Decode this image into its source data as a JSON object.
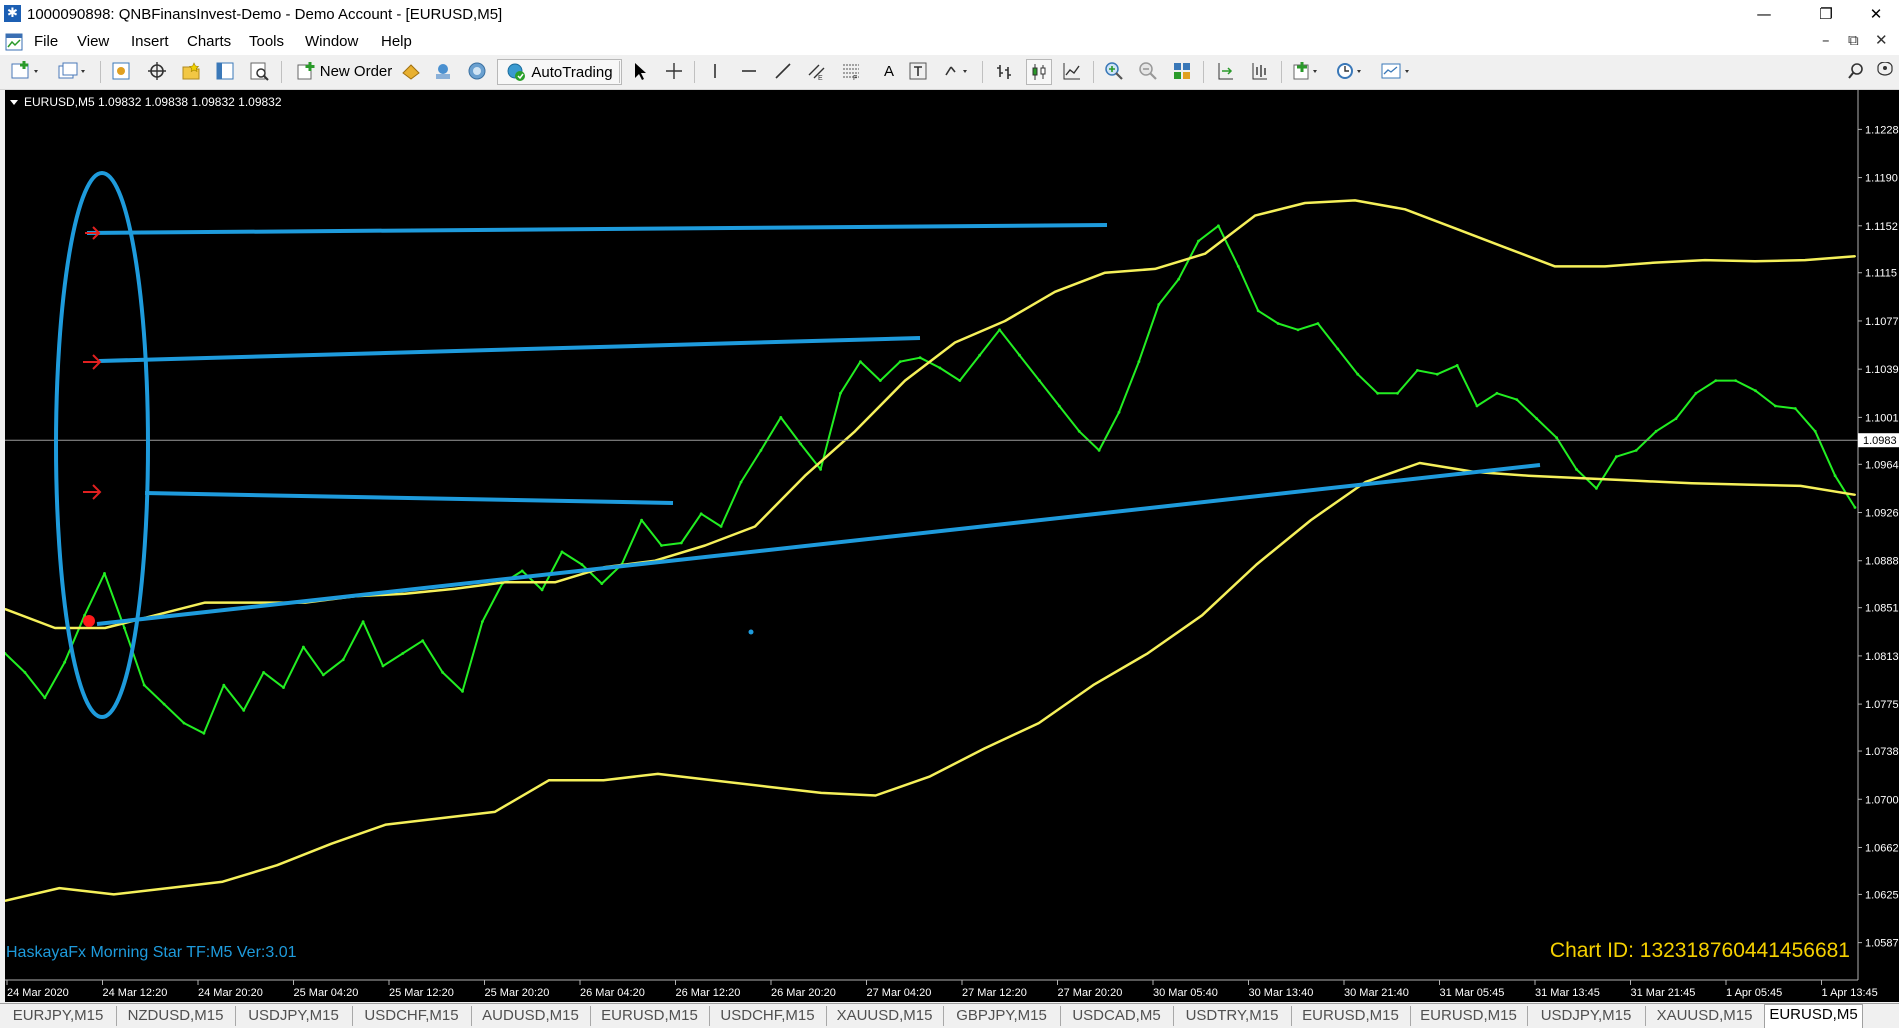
{
  "window": {
    "title": "1000090898: QNBFinansInvest-Demo - Demo Account - [EURUSD,M5]",
    "minimize": "—",
    "maximize": "❐",
    "close": "✕"
  },
  "menu": {
    "items": [
      "File",
      "View",
      "Insert",
      "Charts",
      "Tools",
      "Window",
      "Help"
    ],
    "restore": "–",
    "maximize": "⧉",
    "close": "✕"
  },
  "toolbar": {
    "new_order": "New Order",
    "autotrading": "AutoTrading",
    "text_tool": "A",
    "icons": [
      "new-chart-icon",
      "profiles-icon",
      "market-watch-icon",
      "data-window-icon",
      "navigator-icon",
      "terminal-icon",
      "strategy-tester-icon",
      "new-order-icon",
      "metaeditor-icon",
      "signals-icon",
      "community-icon",
      "autotrading-icon",
      "cursor-icon",
      "crosshair-icon",
      "vertical-line-icon",
      "horizontal-line-icon",
      "trendline-icon",
      "equidistant-channel-icon",
      "fibonacci-icon",
      "text-icon",
      "text-label-icon",
      "arrows-icon",
      "bar-chart-icon",
      "candlesticks-icon",
      "line-chart-icon",
      "zoom-in-icon",
      "zoom-out-icon",
      "tile-windows-icon",
      "chart-shift-icon",
      "autoscroll-icon",
      "indicators-icon",
      "periods-icon",
      "templates-icon"
    ]
  },
  "chart": {
    "header": "EURUSD,M5  1.09832 1.09838 1.09832 1.09832",
    "indicator_label": "HaskayaFx Morning Star TF:M5 Ver:3.01",
    "chart_id": "Chart ID: 132318760441456681",
    "current_price": "1.0983"
  },
  "chart_data": {
    "type": "line",
    "symbol": "EURUSD",
    "timeframe": "M5",
    "ylim": [
      1.0567,
      1.1248
    ],
    "y_ticks": [
      "1.1228",
      "1.1190",
      "1.1152",
      "1.1115",
      "1.1077",
      "1.1039",
      "1.1001",
      "1.0964",
      "1.0926",
      "1.0888",
      "1.0851",
      "1.0813",
      "1.0775",
      "1.0738",
      "1.0700",
      "1.0662",
      "1.0625",
      "1.0587"
    ],
    "x_ticks": [
      "24 Mar 2020",
      "24 Mar 12:20",
      "24 Mar 20:20",
      "25 Mar 04:20",
      "25 Mar 12:20",
      "25 Mar 20:20",
      "26 Mar 04:20",
      "26 Mar 12:20",
      "26 Mar 20:20",
      "27 Mar 04:20",
      "27 Mar 12:20",
      "27 Mar 20:20",
      "30 Mar 05:40",
      "30 Mar 13:40",
      "30 Mar 21:40",
      "31 Mar 05:45",
      "31 Mar 13:45",
      "31 Mar 21:45",
      "1 Apr 05:45",
      "1 Apr 13:45"
    ],
    "current_price": 1.0983,
    "grid": false,
    "series": [
      {
        "color": "#22ee22",
        "values": [
          1.0815,
          1.08,
          1.078,
          1.0808,
          1.0845,
          1.0878,
          1.0835,
          1.079,
          1.0775,
          1.076,
          1.0752,
          1.079,
          1.077,
          1.08,
          1.0788,
          1.082,
          1.0798,
          1.081,
          1.084,
          1.0805,
          1.0815,
          1.0825,
          1.08,
          1.0785,
          1.084,
          1.087,
          1.088,
          1.0865,
          1.0895,
          1.0885,
          1.087,
          1.0885,
          1.092,
          1.09,
          1.0902,
          1.0925,
          1.0915,
          1.095,
          1.0975,
          1.1001,
          1.098,
          1.096,
          1.102,
          1.1045,
          1.103,
          1.1045,
          1.1048,
          1.104,
          1.103,
          1.105,
          1.107,
          1.105,
          1.103,
          1.101,
          1.099,
          1.0975,
          1.1005,
          1.1045,
          1.109,
          1.111,
          1.114,
          1.1152,
          1.112,
          1.1085,
          1.1075,
          1.107,
          1.1075,
          1.1055,
          1.1035,
          1.102,
          1.102,
          1.1038,
          1.1035,
          1.1042,
          1.101,
          1.102,
          1.1015,
          1.1,
          1.0985,
          1.096,
          1.0945,
          1.097,
          1.0975,
          1.099,
          1.1,
          1.102,
          1.103,
          1.103,
          1.1022,
          1.101,
          1.1008,
          1.099,
          1.0955,
          1.093
        ]
      },
      {
        "color": "#f5f05a",
        "values": [
          1.085,
          1.0835,
          1.0835,
          1.0845,
          1.0855,
          1.0855,
          1.0855,
          1.086,
          1.0862,
          1.0866,
          1.0871,
          1.0871,
          1.0883,
          1.0888,
          1.09,
          1.0915,
          1.0955,
          1.099,
          1.103,
          1.106,
          1.1077,
          1.11,
          1.1115,
          1.1118,
          1.113,
          1.116,
          1.117,
          1.1172,
          1.1165,
          1.115,
          1.1135,
          1.112,
          1.112,
          1.1123,
          1.1125,
          1.1124,
          1.1125,
          1.1128
        ]
      },
      {
        "color": "#f5f05a",
        "values": [
          1.062,
          1.063,
          1.0625,
          1.063,
          1.0635,
          1.0648,
          1.0665,
          1.068,
          1.0685,
          1.069,
          1.0715,
          1.0715,
          1.072,
          1.0715,
          1.071,
          1.0705,
          1.0703,
          1.0718,
          1.074,
          1.076,
          1.079,
          1.0815,
          1.0845,
          1.0885,
          1.092,
          1.095,
          1.0965,
          1.0958,
          1.0955,
          1.0953,
          1.0951,
          1.0949,
          1.0948,
          1.0947,
          1.094
        ]
      }
    ]
  },
  "tabs": [
    "EURJPY,M15",
    "NZDUSD,M15",
    "USDJPY,M15",
    "USDCHF,M15",
    "AUDUSD,M15",
    "EURUSD,M15",
    "USDCHF,M15",
    "XAUUSD,M15",
    "GBPJPY,M15",
    "USDCAD,M5",
    "USDTRY,M15",
    "EURUSD,M15",
    "EURUSD,M15",
    "USDJPY,M15",
    "XAUUSD,M15",
    "EURUSD,M5"
  ],
  "colors": {
    "background": "#000000",
    "price": "#22ee22",
    "envelope": "#f5f05a",
    "drawings": "#1e9bdc",
    "arrows": "#e02020",
    "indicator_label": "#1e9bdc",
    "chart_id": "#f5d000"
  }
}
